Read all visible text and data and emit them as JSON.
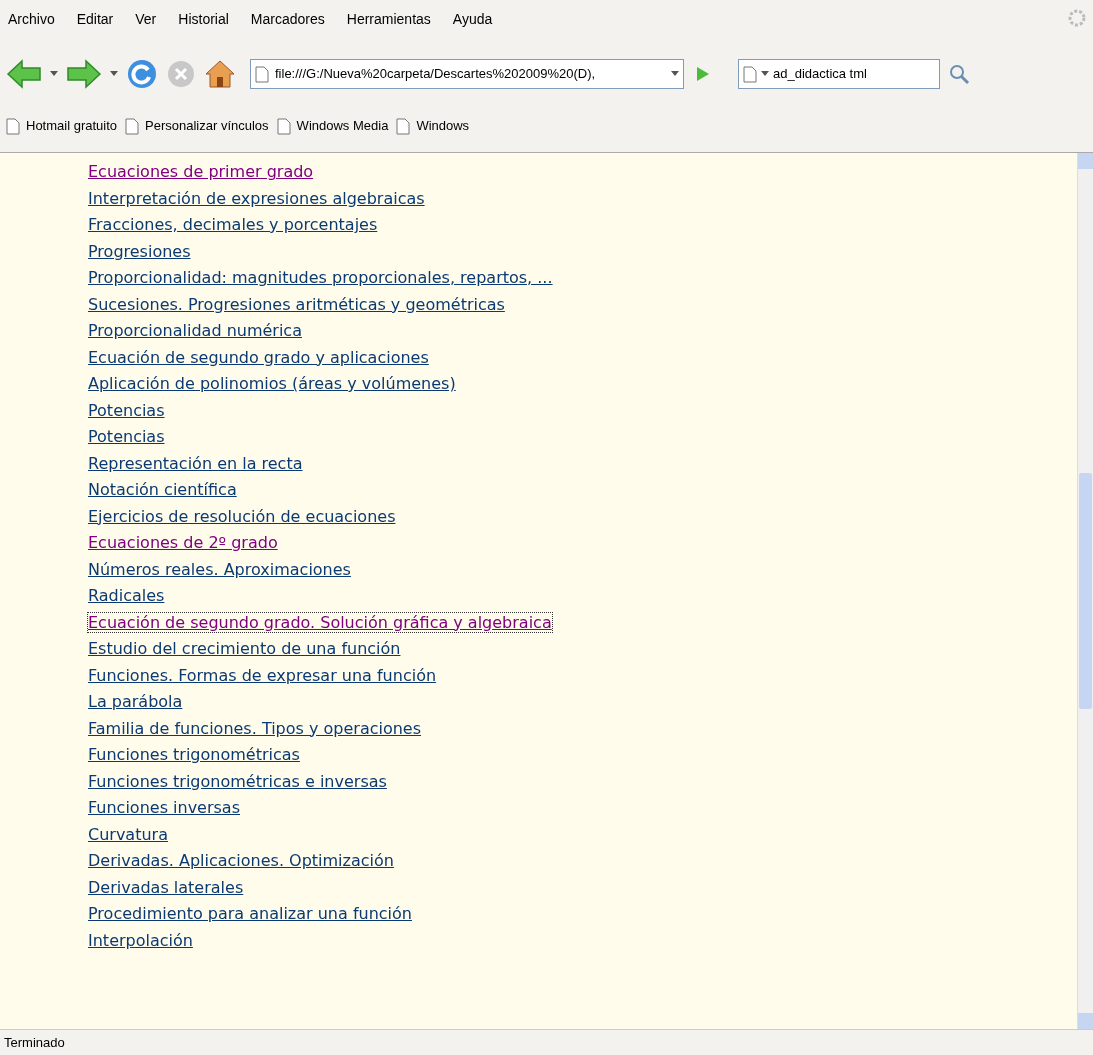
{
  "menu_bar": [
    "Archivo",
    "Editar",
    "Ver",
    "Historial",
    "Marcadores",
    "Herramientas",
    "Ayuda"
  ],
  "toolbar": {
    "address": "file:///G:/Nueva%20carpeta/Descartes%202009%20(D),",
    "search": "ad_didactica tml"
  },
  "bookmarks": [
    "Hotmail gratuito",
    "Personalizar vínculos",
    "Windows Media",
    "Windows"
  ],
  "links": [
    {
      "text": "Ecuaciones de primer grado",
      "visited": true,
      "focused": false
    },
    {
      "text": "Interpretación de expresiones algebraicas",
      "visited": false,
      "focused": false
    },
    {
      "text": "Fracciones, decimales y porcentajes",
      "visited": false,
      "focused": false
    },
    {
      "text": "Progresiones",
      "visited": false,
      "focused": false
    },
    {
      "text": "Proporcionalidad: magnitudes proporcionales, repartos, ...",
      "visited": false,
      "focused": false
    },
    {
      "text": "Sucesiones. Progresiones aritméticas y geométricas",
      "visited": false,
      "focused": false
    },
    {
      "text": "Proporcionalidad numérica",
      "visited": false,
      "focused": false
    },
    {
      "text": "Ecuación de segundo grado y aplicaciones",
      "visited": false,
      "focused": false
    },
    {
      "text": "Aplicación de polinomios (áreas y volúmenes)",
      "visited": false,
      "focused": false
    },
    {
      "text": "Potencias",
      "visited": false,
      "focused": false
    },
    {
      "text": "Potencias",
      "visited": false,
      "focused": false
    },
    {
      "text": "Representación en la recta",
      "visited": false,
      "focused": false
    },
    {
      "text": "Notación científica",
      "visited": false,
      "focused": false
    },
    {
      "text": "Ejercicios de resolución de ecuaciones",
      "visited": false,
      "focused": false
    },
    {
      "text": "Ecuaciones de 2º grado",
      "visited": true,
      "focused": false
    },
    {
      "text": "Números reales. Aproximaciones",
      "visited": false,
      "focused": false
    },
    {
      "text": "Radicales",
      "visited": false,
      "focused": false
    },
    {
      "text": "Ecuación de segundo grado. Solución gráfica y algebraica",
      "visited": true,
      "focused": true
    },
    {
      "text": "Estudio del crecimiento de una función",
      "visited": false,
      "focused": false
    },
    {
      "text": "Funciones. Formas de expresar una función",
      "visited": false,
      "focused": false
    },
    {
      "text": "La parábola",
      "visited": false,
      "focused": false
    },
    {
      "text": "Familia de funciones. Tipos y operaciones",
      "visited": false,
      "focused": false
    },
    {
      "text": "Funciones trigonométricas",
      "visited": false,
      "focused": false
    },
    {
      "text": "Funciones trigonométricas e inversas",
      "visited": false,
      "focused": false
    },
    {
      "text": "Funciones inversas",
      "visited": false,
      "focused": false
    },
    {
      "text": "Curvatura",
      "visited": false,
      "focused": false
    },
    {
      "text": "Derivadas. Aplicaciones. Optimización",
      "visited": false,
      "focused": false
    },
    {
      "text": "Derivadas laterales",
      "visited": false,
      "focused": false
    },
    {
      "text": "Procedimiento para analizar una función",
      "visited": false,
      "focused": false
    },
    {
      "text": "Interpolación",
      "visited": false,
      "focused": false
    }
  ],
  "status_bar": "Terminado"
}
